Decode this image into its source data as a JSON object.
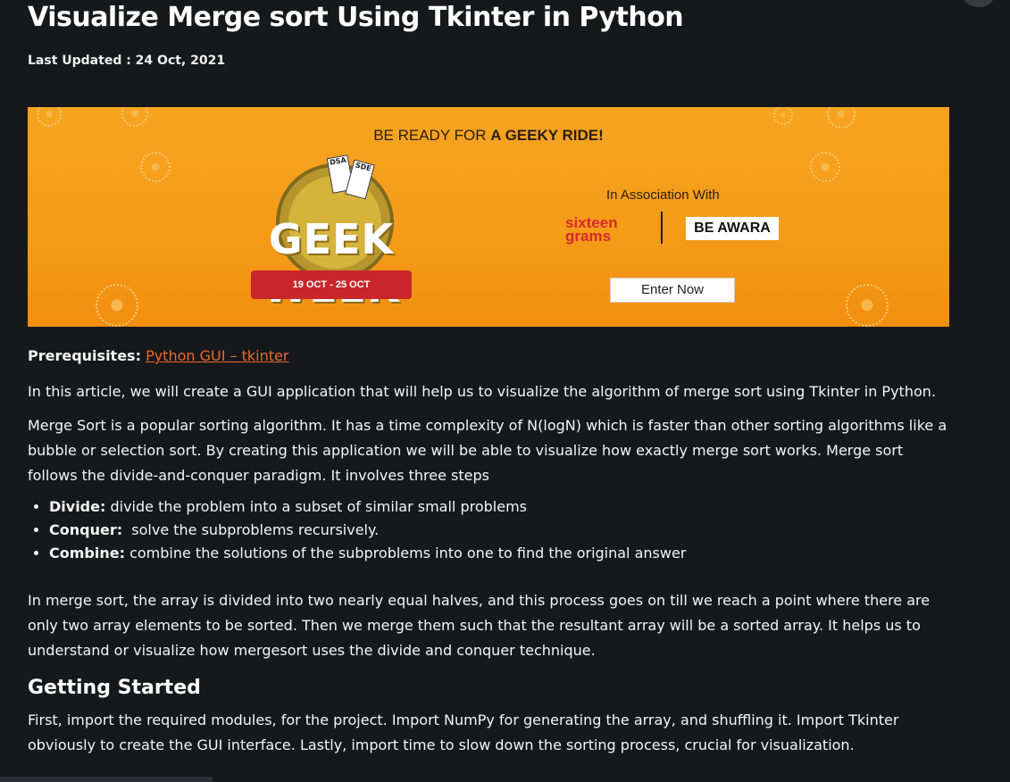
{
  "article": {
    "title": "Visualize Merge sort Using Tkinter in Python",
    "last_updated": "Last Updated : 24 Oct, 2021"
  },
  "banner": {
    "headline_prefix": "BE READY FOR ",
    "headline_bold": "A GEEKY RIDE!",
    "badge_word": "GEEK WEEK",
    "badge_dates": "19 OCT - 25 OCT",
    "tickets": [
      "DSA",
      "SDE"
    ],
    "association": "In Association With",
    "partner1": "sixteen grams",
    "partner2": "BE AWARA",
    "cta": "Enter Now"
  },
  "content": {
    "prereq_label": "Prerequisites:",
    "prereq_link": "Python GUI – tkinter",
    "p1": "In this article, we will create a GUI application that will help us to visualize the algorithm of merge sort using Tkinter in Python.",
    "p2": "Merge Sort is a popular sorting algorithm. It has a time complexity of N(logN) which is faster than other sorting algorithms like a bubble or selection sort. By creating this application we will be able to visualize how exactly merge sort works. Merge sort follows the divide-and-conquer paradigm. It involves three steps",
    "steps": [
      {
        "term": "Divide:",
        "text": " divide the problem into a subset of similar small problems"
      },
      {
        "term": "Conquer:",
        "text": "  solve the subproblems recursively."
      },
      {
        "term": "Combine:",
        "text": " combine the solutions of the subproblems into one to find the original answer"
      }
    ],
    "p3": "In merge sort, the array is divided into two nearly equal halves, and this process goes on till we reach a point where there are only two array elements to be sorted. Then we merge them such that the resultant array will be a sorted array. It helps us to understand or visualize how mergesort uses the divide and conquer technique.",
    "h2": "Getting Started",
    "p4": "First, import the required modules, for the project. Import NumPy for generating the array, and shuffling it. Import Tkinter obviously to create the GUI interface. Lastly, import time to slow down the sorting process, crucial for visualization."
  }
}
